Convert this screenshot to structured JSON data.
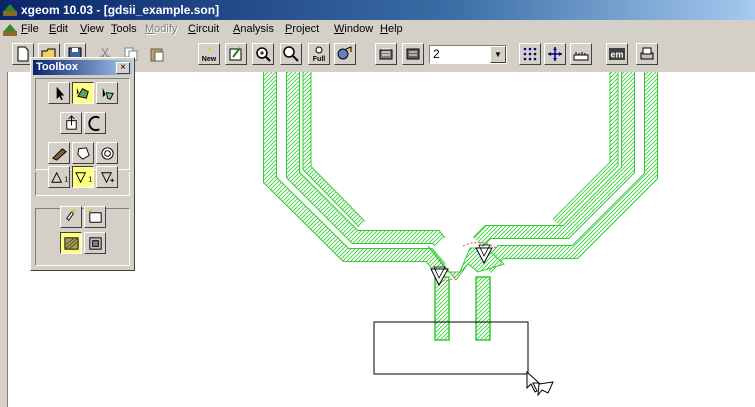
{
  "window": {
    "title": "xgeom 10.03 - [gdsii_example.son]"
  },
  "menu": [
    {
      "id": "file",
      "label": "File",
      "u": "F",
      "rest": "ile",
      "enabled": true
    },
    {
      "id": "edit",
      "label": "Edit",
      "u": "E",
      "rest": "dit",
      "enabled": true
    },
    {
      "id": "view",
      "label": "View",
      "u": "V",
      "rest": "iew",
      "enabled": true
    },
    {
      "id": "tools",
      "label": "Tools",
      "u": "T",
      "rest": "ools",
      "enabled": true
    },
    {
      "id": "modify",
      "label": "Modify",
      "u": "M",
      "rest": "odify",
      "enabled": false
    },
    {
      "id": "circuit",
      "label": "Circuit",
      "u": "C",
      "rest": "ircuit",
      "enabled": true
    },
    {
      "id": "analysis",
      "label": "Analysis",
      "u": "A",
      "rest": "nalysis",
      "enabled": true
    },
    {
      "id": "project",
      "label": "Project",
      "u": "P",
      "rest": "roject",
      "enabled": true
    },
    {
      "id": "window",
      "label": "Window",
      "u": "W",
      "rest": "indow",
      "enabled": true
    },
    {
      "id": "help",
      "label": "Help",
      "u": "H",
      "rest": "elp",
      "enabled": true
    }
  ],
  "toolbar": {
    "buttons": [
      {
        "name": "new-file-icon"
      },
      {
        "name": "open-file-icon"
      },
      {
        "name": "save-icon"
      },
      {
        "name": "cut-icon"
      },
      {
        "name": "copy-icon"
      },
      {
        "name": "paste-icon"
      },
      {
        "name": "new-view-icon",
        "text": "New"
      },
      {
        "name": "edit-view-icon"
      },
      {
        "name": "zoom-in-icon"
      },
      {
        "name": "zoom-out-icon"
      },
      {
        "name": "zoom-full-icon",
        "text": "Full"
      },
      {
        "name": "layers-icon"
      },
      {
        "name": "level-up-icon"
      },
      {
        "name": "level-down-icon"
      },
      {
        "name": "grid-icon"
      },
      {
        "name": "move-cross-icon"
      },
      {
        "name": "ruler-icon"
      },
      {
        "name": "em-icon",
        "text": "em"
      },
      {
        "name": "print-icon"
      }
    ],
    "level_select": {
      "value": "2"
    }
  },
  "toolbox": {
    "title": "Toolbox",
    "close": "×",
    "groups": [
      [
        "pointer-icon",
        "edit-points-icon",
        "reshape-icon"
      ],
      [
        "add-port-icon",
        "curve-icon"
      ],
      [
        "draw-polygon-icon",
        "draw-rect-icon",
        "draw-circle-icon"
      ],
      [
        "via-up-icon",
        "via-down-icon",
        "via-icon"
      ],
      [
        "dielectric-brick-icon",
        "box-icon"
      ],
      [
        "metal-fill-icon",
        "layer-icon"
      ]
    ],
    "active": [
      "edit-points-icon",
      "via-down-icon",
      "metal-fill-icon"
    ],
    "via_labels": {
      "up": "1",
      "down": "1"
    }
  },
  "canvas": {
    "metal_color": "#33cc33",
    "box_color": "#000000"
  }
}
